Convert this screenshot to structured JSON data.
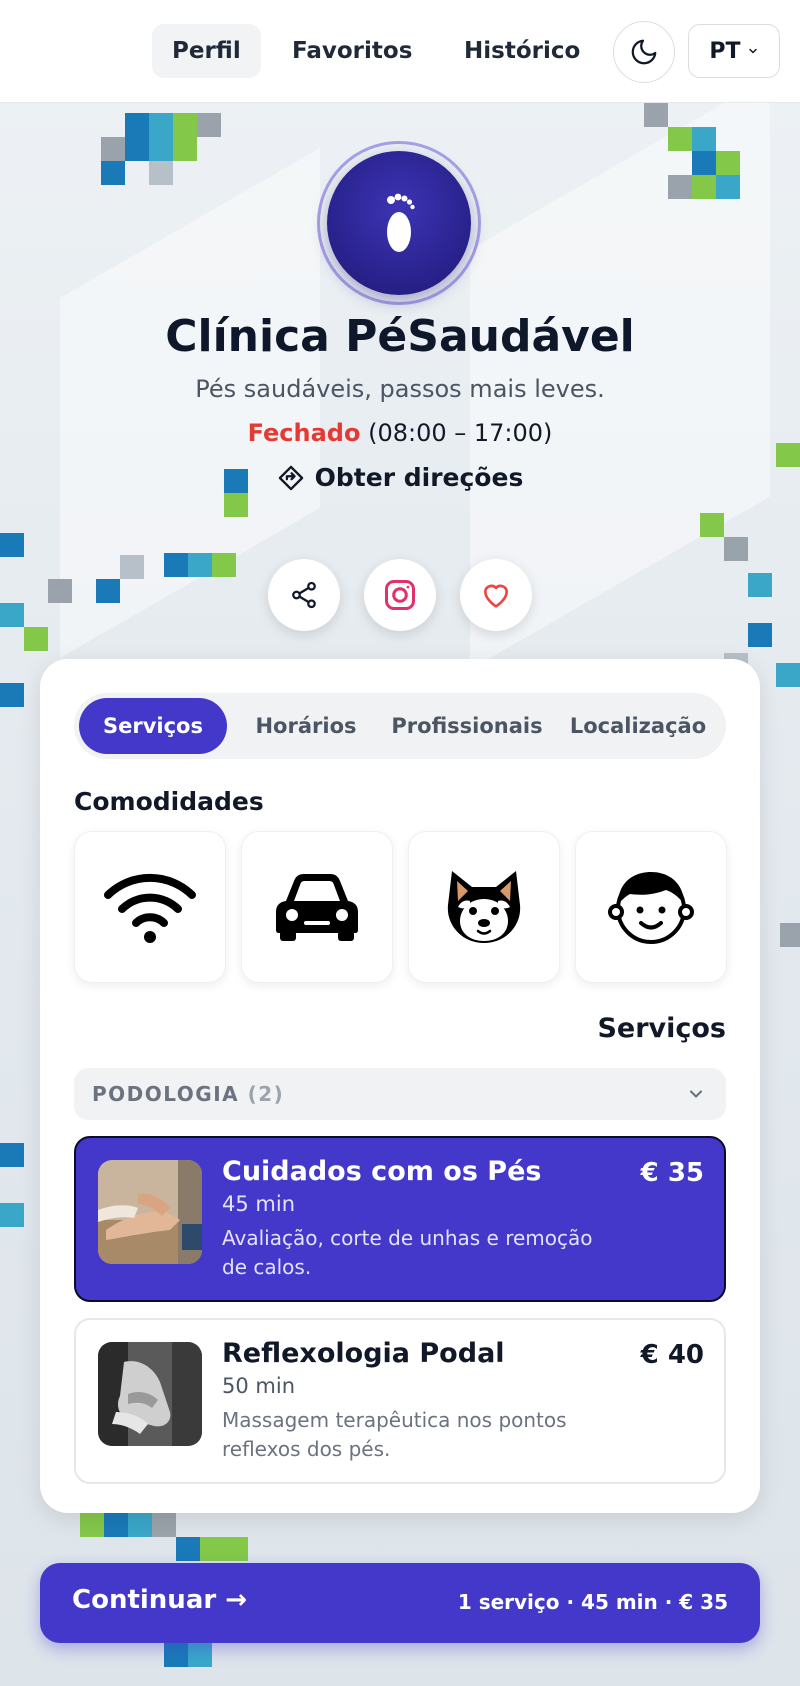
{
  "nav": {
    "tabs": [
      {
        "label": "Perfil",
        "active": true
      },
      {
        "label": "Favoritos",
        "active": false
      },
      {
        "label": "Histórico",
        "active": false
      }
    ],
    "theme_icon": "moon-icon",
    "language": "PT"
  },
  "profile": {
    "logo_icon": "footprint-icon",
    "name": "Clínica PéSaudável",
    "tagline": "Pés saudáveis, passos mais leves.",
    "status": "Fechado",
    "hours": "(08:00 – 17:00)",
    "directions_label": "Obter direções",
    "actions": [
      "share-icon",
      "instagram-icon",
      "heart-icon"
    ]
  },
  "tabs": [
    {
      "label": "Serviços",
      "active": true
    },
    {
      "label": "Horários",
      "active": false
    },
    {
      "label": "Profissionais",
      "active": false
    },
    {
      "label": "Localização",
      "active": false
    }
  ],
  "amenities": {
    "title": "Comodidades",
    "items": [
      "wifi-icon",
      "car-icon",
      "dog-icon",
      "child-icon"
    ]
  },
  "services": {
    "title": "Serviços",
    "category": {
      "label": "PODOLOGIA",
      "count": "(2)"
    },
    "items": [
      {
        "name": "Cuidados com os Pés",
        "duration": "45 min",
        "description": "Avaliação, corte de unhas e remoção de calos.",
        "price": "€ 35",
        "selected": true
      },
      {
        "name": "Reflexologia Podal",
        "duration": "50 min",
        "description": "Massagem terapêutica nos pontos reflexos dos pés.",
        "price": "€ 40",
        "selected": false
      }
    ]
  },
  "footer": {
    "continue_label": "Continuar →",
    "summary": "1 serviço · 45 min · € 35"
  },
  "colors": {
    "accent": "#4338ca",
    "closed": "#e53935",
    "instagram": "#e1306c",
    "heart": "#ef4444"
  }
}
